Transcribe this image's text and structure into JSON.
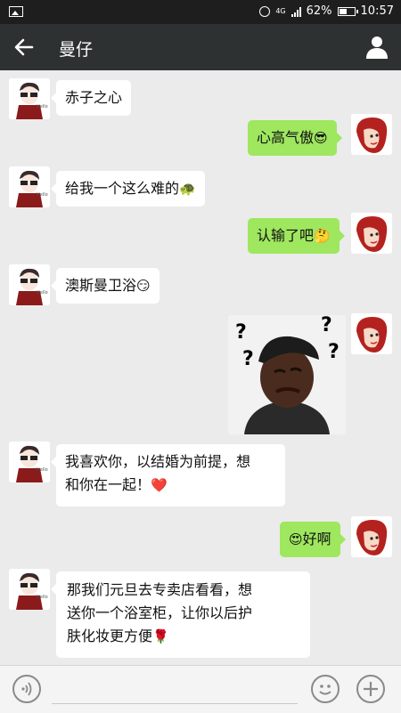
{
  "status_bar": {
    "network": "4G",
    "battery": "62%",
    "battery_level": 0.62,
    "time": "10:57"
  },
  "header": {
    "title": "曼仔",
    "back_icon": "arrow-left-icon",
    "profile_icon": "person-icon"
  },
  "messages": [
    {
      "side": "in",
      "text": "赤子之心",
      "emoji": ""
    },
    {
      "side": "out",
      "text": "心高气傲",
      "emoji": "😎"
    },
    {
      "side": "in",
      "text": "给我一个这么难的",
      "emoji": "🐢"
    },
    {
      "side": "out",
      "text": "认输了吧",
      "emoji": "🤔"
    },
    {
      "side": "in",
      "text": "澳斯曼卫浴",
      "emoji": "😏"
    },
    {
      "side": "out",
      "sticker": "confused-man-sticker"
    },
    {
      "side": "in",
      "line1": "我喜欢你，以结婚为前提，想",
      "line2": "和你在一起！",
      "emoji": "❤️"
    },
    {
      "side": "out",
      "text": "好啊",
      "emoji": "😍"
    },
    {
      "side": "in",
      "line1": "那我们元旦去专卖店看看，想",
      "line2": "送你一个浴室柜，让你以后护",
      "line3": "肤化妆更方便",
      "emoji": "🌹"
    }
  ],
  "input_bar": {
    "voice_icon": "voice-icon",
    "emoji_icon": "emoji-icon",
    "plus_icon": "plus-icon"
  }
}
